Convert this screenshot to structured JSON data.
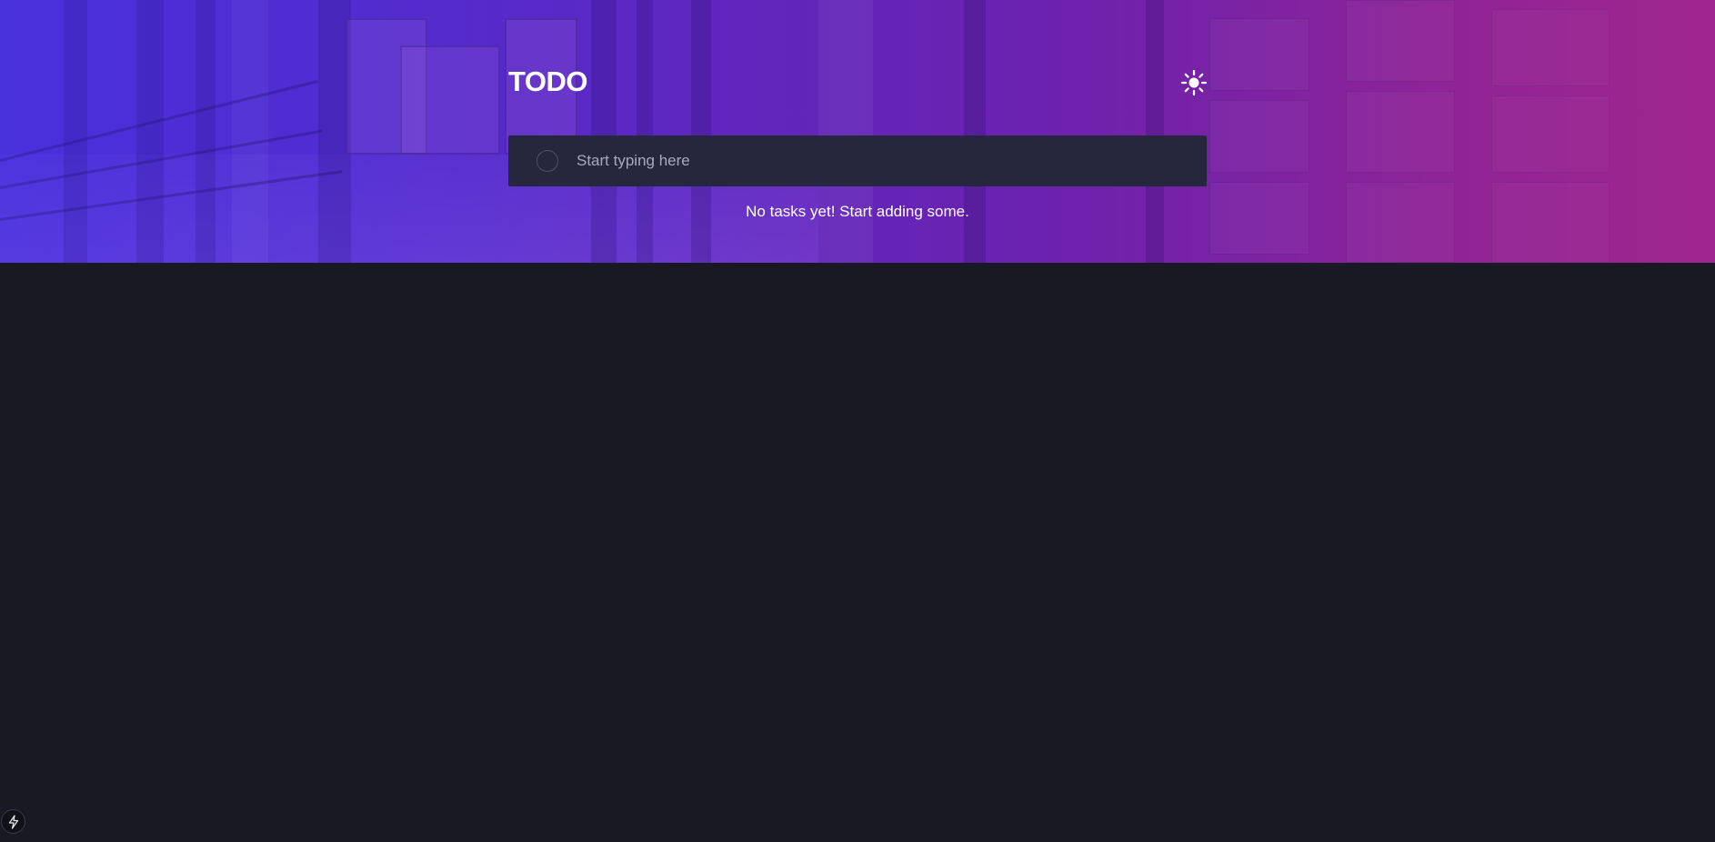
{
  "app": {
    "title": "TODO"
  },
  "header": {
    "theme_toggle_icon": "sun-icon"
  },
  "new_todo": {
    "placeholder": "Start typing here",
    "value": ""
  },
  "todos": {
    "items": [],
    "empty_message": "No tasks yet! Start adding some."
  },
  "dev_indicator": {
    "icon": "lightning-icon"
  },
  "colors": {
    "page_background": "#181923",
    "input_background": "#25273c",
    "gradient_start": "#4a2fd6",
    "gradient_end": "#9a2590",
    "title_text": "#ffffff",
    "placeholder_text": "#a7a9c0"
  }
}
